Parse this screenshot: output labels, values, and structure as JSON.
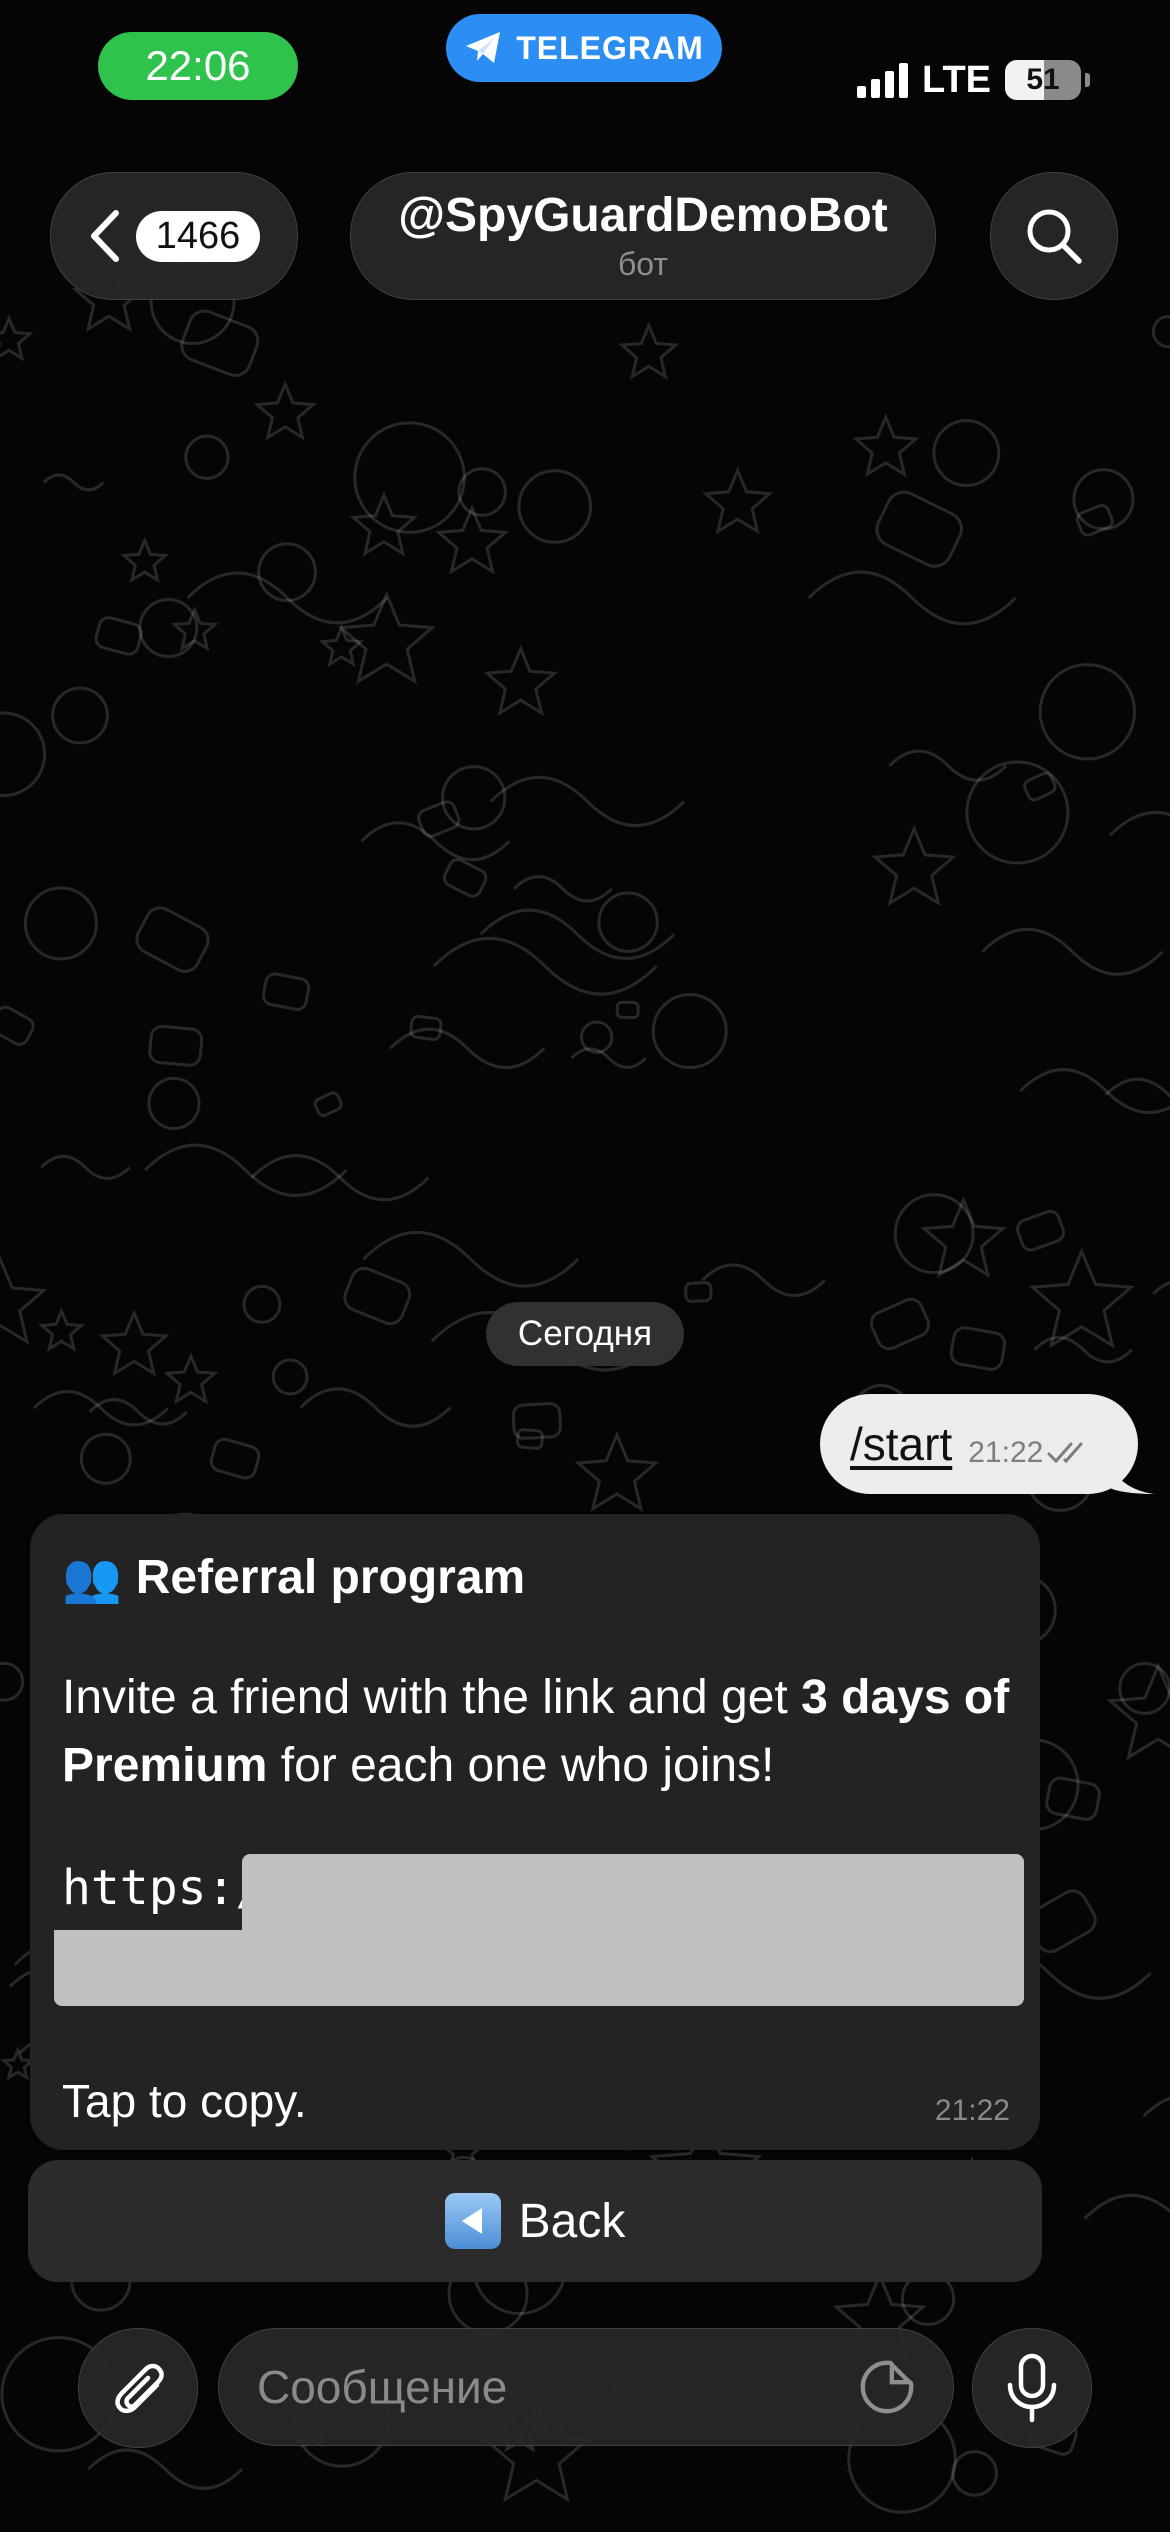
{
  "status_bar": {
    "time": "22:06",
    "app_indicator": "TELEGRAM",
    "network": "LTE",
    "battery_level": "51",
    "battery_fraction": 0.51,
    "signal_bars": 4
  },
  "header": {
    "back_count": "1466",
    "chat_title": "@SpyGuardDemoBot",
    "chat_subtitle": "бот",
    "icons": [
      "chevron-left-icon",
      "search-icon"
    ]
  },
  "chat": {
    "date_separator": "Сегодня",
    "outgoing": {
      "text": "/start",
      "time": "21:22",
      "status": "read"
    },
    "incoming": {
      "emoji": "👥",
      "title": "Referral program",
      "body_part1": "Invite a friend with the link and get ",
      "body_bold1": "3 days of Premium",
      "body_part2": " for each one who joins!",
      "link_visible": "https:/",
      "footer": "Tap to copy.",
      "time": "21:22"
    }
  },
  "keyboard": {
    "back_button_label": "Back",
    "back_button_icon": "left-arrow-square-icon"
  },
  "composer": {
    "placeholder": "Сообщение",
    "icons": [
      "paperclip-icon",
      "sticker-icon",
      "microphone-icon"
    ]
  },
  "colors": {
    "time_pill": "#2fc34d",
    "telegram_pill": "#2c8ef2",
    "outgoing_bubble": "#ececec",
    "incoming_bubble": "#232323",
    "background": "#050505"
  }
}
